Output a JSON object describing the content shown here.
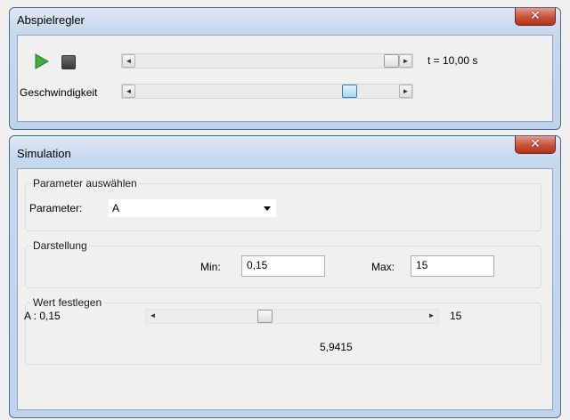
{
  "player_window": {
    "title": "Abspielregler",
    "close_glyph": "✕",
    "time_readout": "t = 10,00 s",
    "speed_label": "Geschwindigkeit",
    "time_slider_value": 1.0,
    "speed_slider_value": 0.83
  },
  "simulation_window": {
    "title": "Simulation",
    "close_glyph": "✕",
    "parameter_group": {
      "legend": "Parameter auswählen",
      "label": "Parameter:",
      "selected": "A"
    },
    "display_group": {
      "legend": "Darstellung",
      "min_label": "Min:",
      "min_value": "0,15",
      "max_label": "Max:",
      "max_value": "15"
    },
    "value_group": {
      "legend": "Wert festlegen",
      "range_min_label": "A : 0,15",
      "range_max_label": "15",
      "current_value": "5,9415",
      "slider_value": 0.39
    }
  }
}
